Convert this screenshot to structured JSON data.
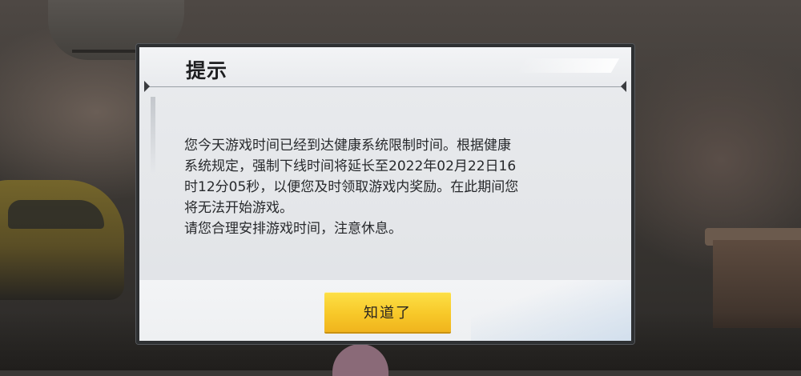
{
  "dialog": {
    "title": "提示",
    "body_lines": [
      "您今天游戏时间已经到达健康系统限制时间。根据健康",
      "系统规定，强制下线时间将延长至2022年02月22日16",
      "时12分05秒，以便您及时领取游戏内奖励。在此期间您",
      "将无法开始游戏。",
      "请您合理安排游戏时间，注意休息。"
    ],
    "ok_button_label": "知道了"
  },
  "colors": {
    "button_accent": "#f7c829",
    "dialog_background": "#e6e8eb",
    "dialog_border": "#2e3032"
  }
}
